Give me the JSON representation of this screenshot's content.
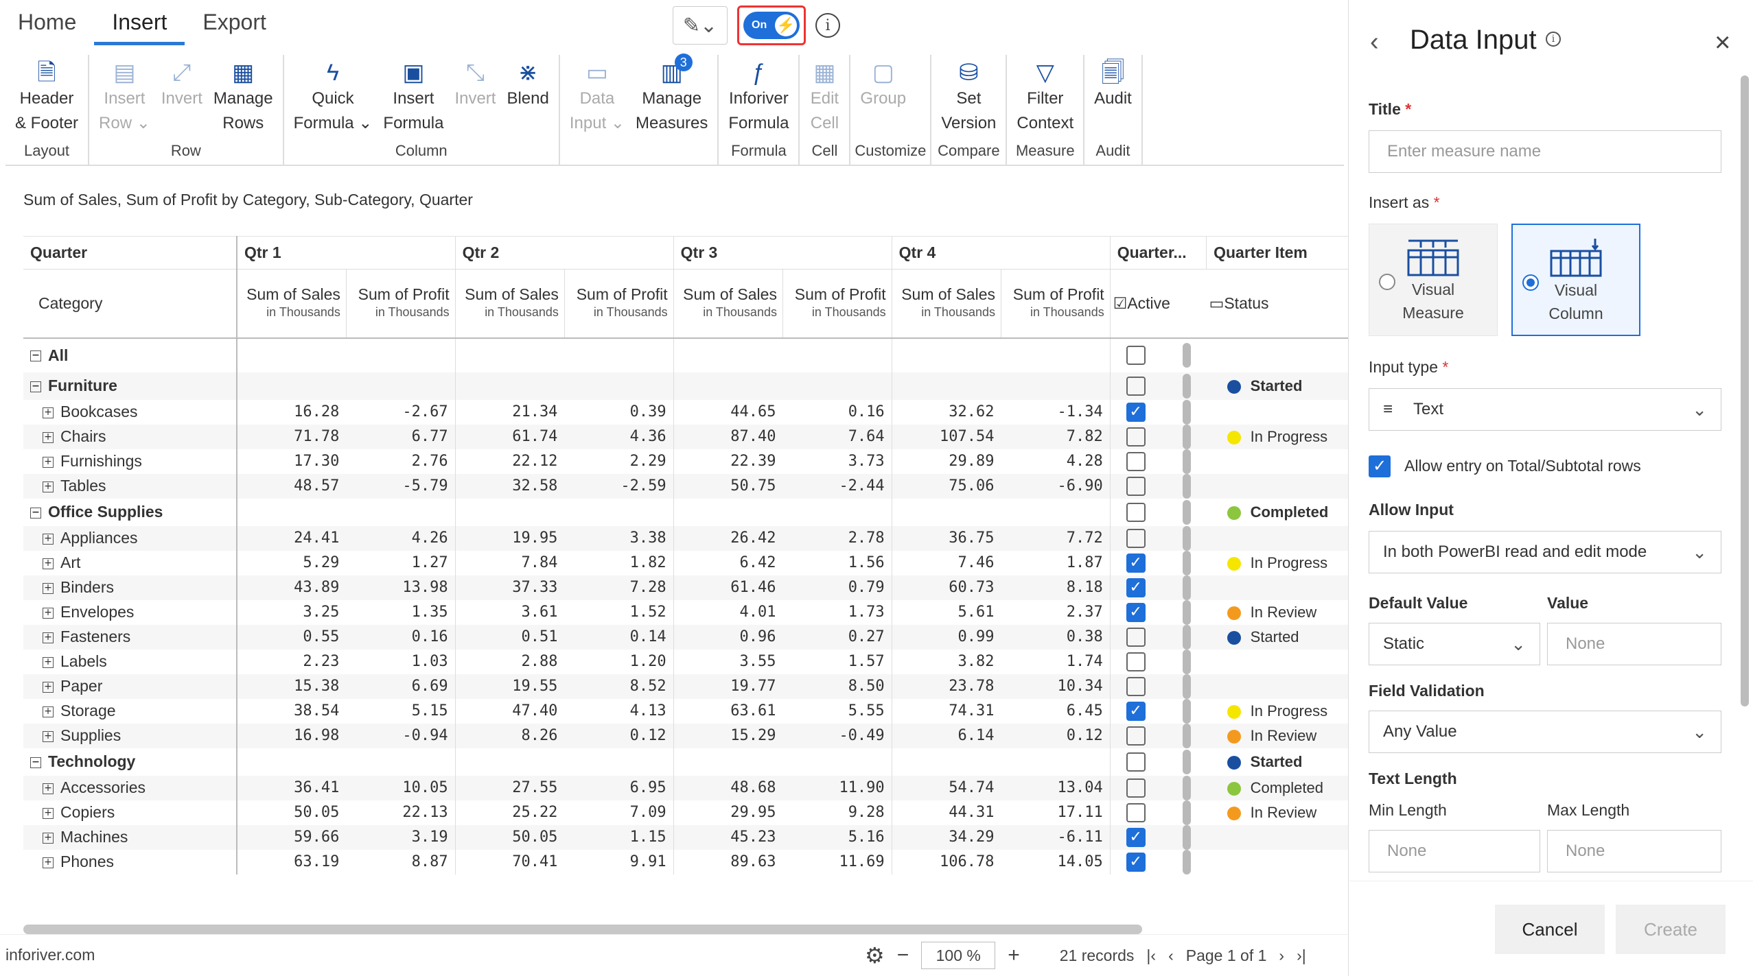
{
  "tabs": [
    "Home",
    "Insert",
    "Export"
  ],
  "toggle": {
    "label": "On"
  },
  "ribbon": [
    {
      "group": "Layout",
      "buttons": [
        {
          "l1": "Header",
          "l2": "& Footer",
          "icon": "header-footer-icon",
          "dis": false
        }
      ]
    },
    {
      "group": "Row",
      "buttons": [
        {
          "l1": "Insert",
          "l2": "Row ⌄",
          "icon": "insert-row-icon",
          "dis": true
        },
        {
          "l1": "Invert",
          "l2": "",
          "icon": "invert-row-icon",
          "dis": true
        },
        {
          "l1": "Manage",
          "l2": "Rows",
          "icon": "manage-rows-icon",
          "dis": false
        }
      ]
    },
    {
      "group": "Column",
      "buttons": [
        {
          "l1": "Quick",
          "l2": "Formula ⌄",
          "icon": "quick-formula-icon",
          "dis": false
        },
        {
          "l1": "Insert",
          "l2": "Formula",
          "icon": "insert-formula-icon",
          "dis": false
        },
        {
          "l1": "Invert",
          "l2": "",
          "icon": "invert-column-icon",
          "dis": true
        },
        {
          "l1": "Blend",
          "l2": "",
          "icon": "blend-icon",
          "dis": false
        }
      ]
    },
    {
      "group": "",
      "buttons": [
        {
          "l1": "Data",
          "l2": "Input ⌄",
          "icon": "data-input-icon",
          "dis": true
        },
        {
          "l1": "Manage",
          "l2": "Measures",
          "icon": "manage-measures-icon",
          "dis": false,
          "badge": "3"
        }
      ]
    },
    {
      "group": "Formula",
      "buttons": [
        {
          "l1": "Inforiver",
          "l2": "Formula",
          "icon": "inforiver-formula-icon",
          "dis": false
        }
      ]
    },
    {
      "group": "Cell",
      "buttons": [
        {
          "l1": "Edit",
          "l2": "Cell",
          "icon": "edit-cell-icon",
          "dis": true
        }
      ]
    },
    {
      "group": "Customize",
      "buttons": [
        {
          "l1": "Group",
          "l2": "",
          "icon": "group-icon",
          "dis": true
        }
      ]
    },
    {
      "group": "Compare",
      "buttons": [
        {
          "l1": "Set",
          "l2": "Version",
          "icon": "set-version-icon",
          "dis": false
        }
      ]
    },
    {
      "group": "Measure",
      "buttons": [
        {
          "l1": "Filter",
          "l2": "Context",
          "icon": "filter-icon",
          "dis": false
        }
      ]
    },
    {
      "group": "Audit",
      "buttons": [
        {
          "l1": "Audit",
          "l2": "",
          "icon": "audit-icon",
          "dis": false
        }
      ]
    }
  ],
  "subtitle": "Sum of Sales, Sum of Profit by Category, Sub-Category, Quarter",
  "table": {
    "corner": "Quarter",
    "category_label": "Category",
    "quarters": [
      "Qtr 1",
      "Qtr 2",
      "Qtr 3",
      "Qtr 4"
    ],
    "extra_headers": [
      "Quarter...",
      "Quarter Item"
    ],
    "measure_headers": [
      {
        "name": "Sum of Sales",
        "unit": "in Thousands"
      },
      {
        "name": "Sum of Profit",
        "unit": "in Thousands"
      }
    ],
    "active_label": "☑Active",
    "status_label": "▭Status",
    "rows": [
      {
        "name": "All",
        "type": "grp",
        "v": [],
        "chk": false,
        "status": "",
        "color": ""
      },
      {
        "name": "Furniture",
        "type": "grp",
        "v": [],
        "chk": false,
        "status": "Started",
        "color": "#1a4fa0"
      },
      {
        "name": "Bookcases",
        "type": "sub",
        "v": [
          "16.28",
          "-2.67",
          "21.34",
          "0.39",
          "44.65",
          "0.16",
          "32.62",
          "-1.34"
        ],
        "chk": true,
        "status": "",
        "color": ""
      },
      {
        "name": "Chairs",
        "type": "sub",
        "v": [
          "71.78",
          "6.77",
          "61.74",
          "4.36",
          "87.40",
          "7.64",
          "107.54",
          "7.82"
        ],
        "chk": false,
        "status": "In Progress",
        "color": "#f5e600"
      },
      {
        "name": "Furnishings",
        "type": "sub",
        "v": [
          "17.30",
          "2.76",
          "22.12",
          "2.29",
          "22.39",
          "3.73",
          "29.89",
          "4.28"
        ],
        "chk": false,
        "status": "",
        "color": ""
      },
      {
        "name": "Tables",
        "type": "sub",
        "v": [
          "48.57",
          "-5.79",
          "32.58",
          "-2.59",
          "50.75",
          "-2.44",
          "75.06",
          "-6.90"
        ],
        "chk": false,
        "status": "",
        "color": ""
      },
      {
        "name": "Office Supplies",
        "type": "grp",
        "v": [],
        "chk": false,
        "status": "Completed",
        "color": "#8cc63f"
      },
      {
        "name": "Appliances",
        "type": "sub",
        "v": [
          "24.41",
          "4.26",
          "19.95",
          "3.38",
          "26.42",
          "2.78",
          "36.75",
          "7.72"
        ],
        "chk": false,
        "status": "",
        "color": ""
      },
      {
        "name": "Art",
        "type": "sub",
        "v": [
          "5.29",
          "1.27",
          "7.84",
          "1.82",
          "6.42",
          "1.56",
          "7.46",
          "1.87"
        ],
        "chk": true,
        "status": "In Progress",
        "color": "#f5e600"
      },
      {
        "name": "Binders",
        "type": "sub",
        "v": [
          "43.89",
          "13.98",
          "37.33",
          "7.28",
          "61.46",
          "0.79",
          "60.73",
          "8.18"
        ],
        "chk": true,
        "status": "",
        "color": ""
      },
      {
        "name": "Envelopes",
        "type": "sub",
        "v": [
          "3.25",
          "1.35",
          "3.61",
          "1.52",
          "4.01",
          "1.73",
          "5.61",
          "2.37"
        ],
        "chk": true,
        "status": "In Review",
        "color": "#f39a1e"
      },
      {
        "name": "Fasteners",
        "type": "sub",
        "v": [
          "0.55",
          "0.16",
          "0.51",
          "0.14",
          "0.96",
          "0.27",
          "0.99",
          "0.38"
        ],
        "chk": false,
        "status": "Started",
        "color": "#1a4fa0"
      },
      {
        "name": "Labels",
        "type": "sub",
        "v": [
          "2.23",
          "1.03",
          "2.88",
          "1.20",
          "3.55",
          "1.57",
          "3.82",
          "1.74"
        ],
        "chk": false,
        "status": "",
        "color": ""
      },
      {
        "name": "Paper",
        "type": "sub",
        "v": [
          "15.38",
          "6.69",
          "19.55",
          "8.52",
          "19.77",
          "8.50",
          "23.78",
          "10.34"
        ],
        "chk": false,
        "status": "",
        "color": ""
      },
      {
        "name": "Storage",
        "type": "sub",
        "v": [
          "38.54",
          "5.15",
          "47.40",
          "4.13",
          "63.61",
          "5.55",
          "74.31",
          "6.45"
        ],
        "chk": true,
        "status": "In Progress",
        "color": "#f5e600"
      },
      {
        "name": "Supplies",
        "type": "sub",
        "v": [
          "16.98",
          "-0.94",
          "8.26",
          "0.12",
          "15.29",
          "-0.49",
          "6.14",
          "0.12"
        ],
        "chk": false,
        "status": "In Review",
        "color": "#f39a1e"
      },
      {
        "name": "Technology",
        "type": "grp",
        "v": [],
        "chk": false,
        "status": "Started",
        "color": "#1a4fa0"
      },
      {
        "name": "Accessories",
        "type": "sub",
        "v": [
          "36.41",
          "10.05",
          "27.55",
          "6.95",
          "48.68",
          "11.90",
          "54.74",
          "13.04"
        ],
        "chk": false,
        "status": "Completed",
        "color": "#8cc63f"
      },
      {
        "name": "Copiers",
        "type": "sub",
        "v": [
          "50.05",
          "22.13",
          "25.22",
          "7.09",
          "29.95",
          "9.28",
          "44.31",
          "17.11"
        ],
        "chk": false,
        "status": "In Review",
        "color": "#f39a1e"
      },
      {
        "name": "Machines",
        "type": "sub",
        "v": [
          "59.66",
          "3.19",
          "50.05",
          "1.15",
          "45.23",
          "5.16",
          "34.29",
          "-6.11"
        ],
        "chk": true,
        "status": "",
        "color": ""
      },
      {
        "name": "Phones",
        "type": "sub",
        "v": [
          "63.19",
          "8.87",
          "70.41",
          "9.91",
          "89.63",
          "11.69",
          "106.78",
          "14.05"
        ],
        "chk": true,
        "status": "",
        "color": ""
      }
    ]
  },
  "footer": {
    "site": "inforiver.com",
    "zoom": "100 %",
    "records": "21 records",
    "page": "Page 1 of 1"
  },
  "panel": {
    "title": "Data Input",
    "title_label": "Title",
    "title_placeholder": "Enter measure name",
    "insert_as_label": "Insert as",
    "opt1": [
      "Visual",
      "Measure"
    ],
    "opt2": [
      "Visual",
      "Column"
    ],
    "input_type_label": "Input type",
    "input_type_value": "Text",
    "allow_total_label": "Allow entry on Total/Subtotal rows",
    "allow_input_label": "Allow Input",
    "allow_input_value": "In both PowerBI read and edit mode",
    "default_value_label": "Default Value",
    "default_value": "Static",
    "value_label": "Value",
    "value_placeholder": "None",
    "field_validation_label": "Field Validation",
    "field_validation_value": "Any Value",
    "text_length_label": "Text Length",
    "min_label": "Min Length",
    "max_label": "Max Length",
    "min_placeholder": "None",
    "max_placeholder": "None",
    "cancel": "Cancel",
    "create": "Create"
  }
}
